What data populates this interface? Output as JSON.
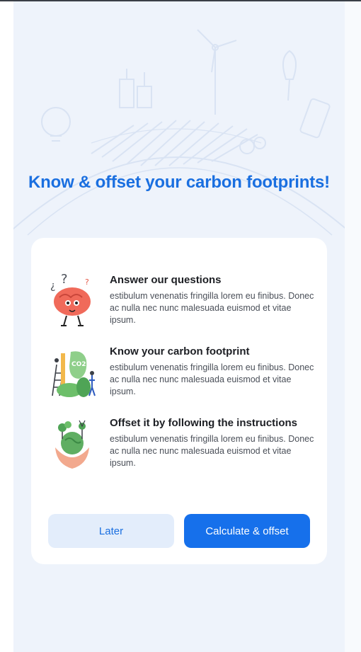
{
  "headline": "Know & offset your carbon footprints!",
  "items": [
    {
      "title": "Answer our questions",
      "description": "estibulum venenatis fringilla lorem eu finibus. Donec ac nulla nec nunc malesuada euismod et vitae ipsum.",
      "icon": "brain-thinking-illustration"
    },
    {
      "title": "Know your carbon footprint",
      "description": "estibulum venenatis fringilla lorem eu finibus. Donec ac nulla nec nunc malesuada euismod et vitae ipsum.",
      "icon": "carbon-footprint-illustration"
    },
    {
      "title": "Offset it by following the instructions",
      "description": "estibulum venenatis fringilla lorem eu finibus. Donec ac nulla nec nunc malesuada euismod et vitae ipsum.",
      "icon": "earth-in-hands-illustration"
    }
  ],
  "buttons": {
    "later": "Later",
    "calculate": "Calculate & offset"
  },
  "colors": {
    "accent": "#1670eb",
    "background": "#eef3fb",
    "secondary_button": "#e3edfb"
  }
}
